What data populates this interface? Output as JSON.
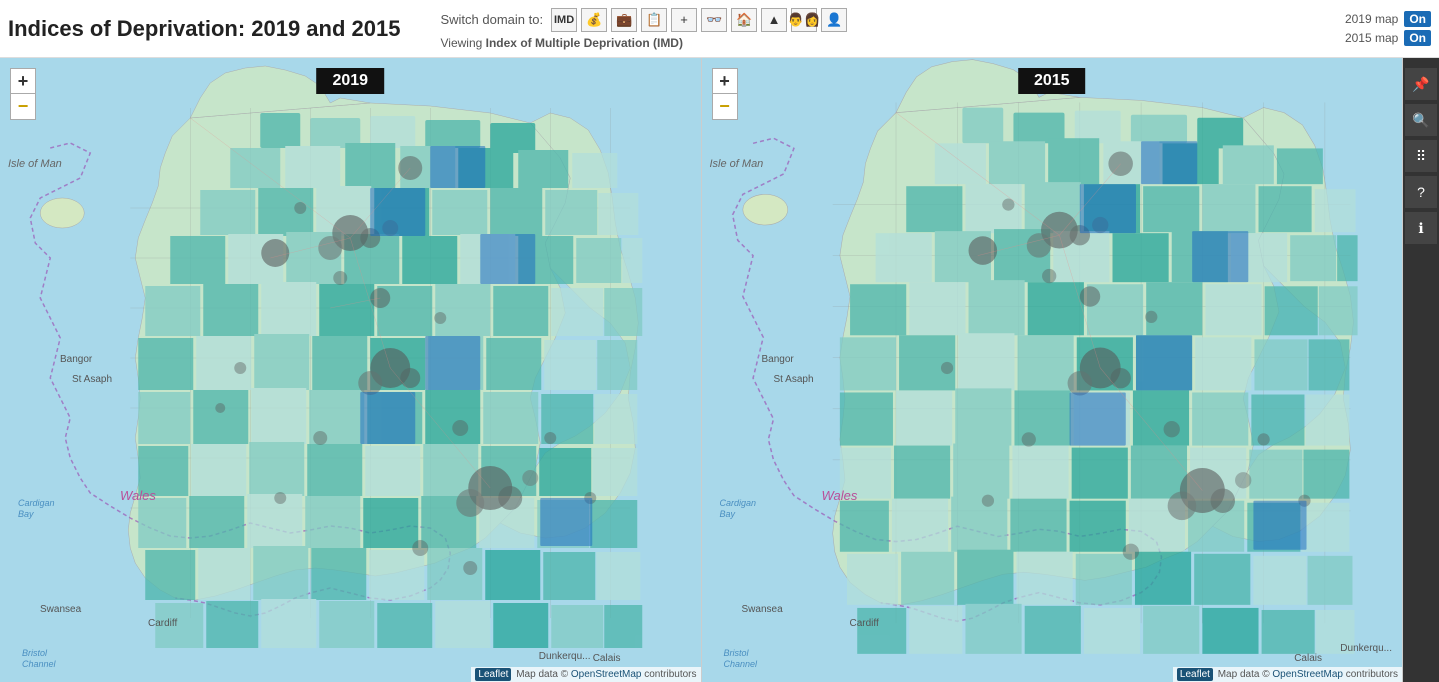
{
  "header": {
    "title": "Indices of Deprivation: 2019 and 2015",
    "switch_domain_label": "Switch domain to:",
    "viewing_label": "Viewing",
    "viewing_value": "Index of Multiple Deprivation (IMD)",
    "domain_buttons": [
      {
        "id": "imd",
        "label": "IMD",
        "icon": "IMD"
      },
      {
        "id": "income",
        "label": "Income",
        "icon": "💰"
      },
      {
        "id": "employment",
        "label": "Employment",
        "icon": "💼"
      },
      {
        "id": "education",
        "label": "Education",
        "icon": "📋"
      },
      {
        "id": "health",
        "label": "Health",
        "icon": "+"
      },
      {
        "id": "crime",
        "label": "Crime",
        "icon": "👓"
      },
      {
        "id": "housing",
        "label": "Housing",
        "icon": "🏠"
      },
      {
        "id": "environment",
        "label": "Environment",
        "icon": "▲"
      },
      {
        "id": "barriers",
        "label": "Barriers",
        "icon": "👨‍👩"
      },
      {
        "id": "idaci",
        "label": "IDACI",
        "icon": "👤"
      }
    ],
    "map_2019_label": "2019 map",
    "map_2015_label": "2015 map",
    "toggle_on": "On"
  },
  "maps": [
    {
      "id": "map-2019",
      "year": "2019",
      "zoom_plus": "+",
      "zoom_minus": "−",
      "isle_of_man": "Isle of Man",
      "wales": "Wales",
      "bangor": "Bangor",
      "st_asaph": "St Asaph",
      "cardiff": "Cardiff",
      "swansea": "Swansea",
      "bristol_channel": "Bristol\nChannel",
      "cardigan_bay": "Cardigan\nBay",
      "calais": "Calais",
      "attribution_leaflet": "Leaflet",
      "attribution_text": "Map data © OpenStreetMap contributors"
    },
    {
      "id": "map-2015",
      "year": "2015",
      "zoom_plus": "+",
      "zoom_minus": "−",
      "isle_of_man": "Isle of Man",
      "wales": "Wales",
      "bangor": "Bangor",
      "st_asaph": "St Asaph",
      "cardiff": "Cardiff",
      "swansea": "Swansea",
      "bristol_channel": "Bristol\nChannel",
      "cardigan_bay": "Cardigan\nBay",
      "calais": "Calais",
      "dunkerque": "Dunkerqu",
      "attribution_leaflet": "Leaflet",
      "attribution_text": "Map data © OpenStreetMap contributors"
    }
  ],
  "sidebar_tools": [
    {
      "id": "pin",
      "icon": "📌",
      "label": "pin-tool"
    },
    {
      "id": "search",
      "icon": "🔍",
      "label": "search-tool"
    },
    {
      "id": "grid",
      "icon": "⠿",
      "label": "grid-tool"
    },
    {
      "id": "help",
      "icon": "?",
      "label": "help-tool"
    },
    {
      "id": "info",
      "icon": "ℹ",
      "label": "info-tool"
    }
  ]
}
